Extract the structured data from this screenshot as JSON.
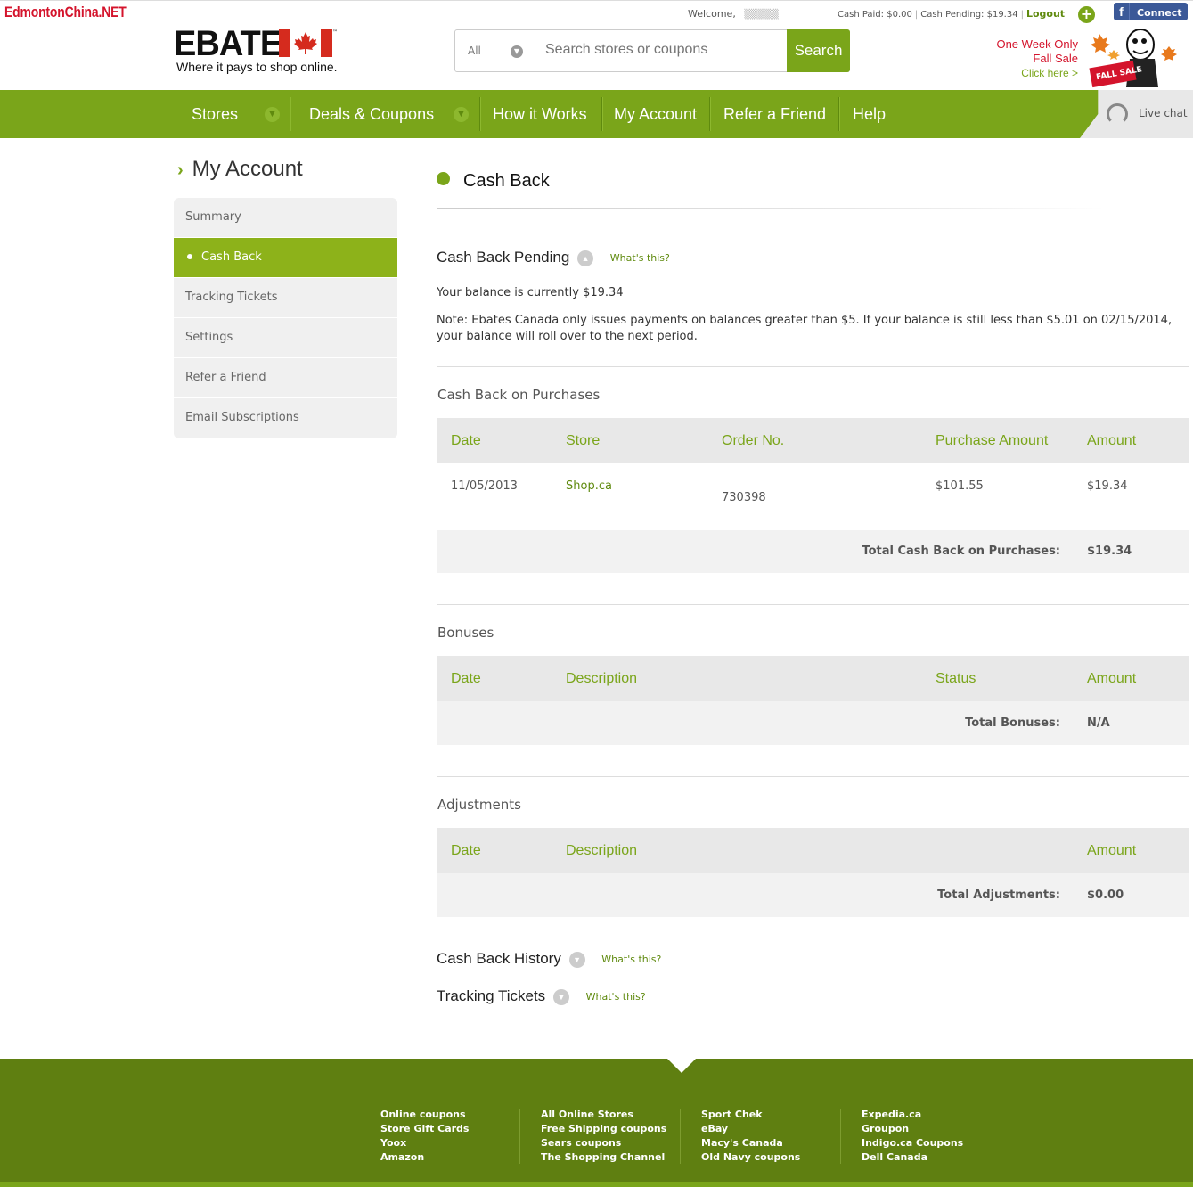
{
  "watermark": "EdmontonChina.NET",
  "header": {
    "welcome_label": "Welcome,",
    "cash_paid": "Cash Paid: $0.00",
    "cash_pending": "Cash Pending: $19.34",
    "logout": "Logout",
    "facebook_connect": "Connect",
    "logo_text": "EBATES",
    "logo_trademark": "™",
    "tagline": "Where it pays to shop online.",
    "promo_line1": "One Week Only",
    "promo_line2": "Fall Sale",
    "promo_link": "Click here >",
    "promo_badge": "FALL SALE"
  },
  "search": {
    "category": "All",
    "placeholder": "Search stores or coupons",
    "button": "Search"
  },
  "nav": {
    "items": [
      "Stores",
      "Deals & Coupons",
      "How it Works",
      "My Account",
      "Refer a Friend",
      "Help"
    ],
    "live_chat": "Live chat"
  },
  "sidebar": {
    "title": "My Account",
    "items": [
      "Summary",
      "Cash Back",
      "Tracking Tickets",
      "Settings",
      "Refer a Friend",
      "Email Subscriptions"
    ],
    "active_index": 1
  },
  "main": {
    "title": "Cash Back",
    "pending": {
      "heading": "Cash Back Pending",
      "whats_this": "What's this?",
      "balance": "Your balance is currently $19.34",
      "note": "Note: Ebates Canada only issues payments on balances greater than $5. If your balance is still less than $5.01 on 02/15/2014, your balance will roll over to the next period."
    },
    "purchases": {
      "heading": "Cash Back on Purchases",
      "columns": [
        "Date",
        "Store",
        "Order No.",
        "Purchase Amount",
        "Amount"
      ],
      "rows": [
        {
          "date": "11/05/2013",
          "store": "Shop.ca",
          "order_no": "730398",
          "purchase_amount": "$101.55",
          "amount": "$19.34"
        }
      ],
      "total_label": "Total Cash Back on Purchases:",
      "total_value": "$19.34"
    },
    "bonuses": {
      "heading": "Bonuses",
      "columns": [
        "Date",
        "Description",
        "Status",
        "Amount"
      ],
      "total_label": "Total Bonuses:",
      "total_value": "N/A"
    },
    "adjustments": {
      "heading": "Adjustments",
      "columns": [
        "Date",
        "Description",
        "Amount"
      ],
      "total_label": "Total Adjustments:",
      "total_value": "$0.00"
    },
    "history": {
      "heading": "Cash Back History",
      "whats_this": "What's this?"
    },
    "tickets": {
      "heading": "Tracking Tickets",
      "whats_this": "What's this?"
    }
  },
  "footer": {
    "col1": [
      "Online coupons",
      "Store Gift Cards",
      "Yoox",
      "Amazon"
    ],
    "col2": [
      "All Online Stores",
      "Free Shipping coupons",
      "Sears coupons",
      "The Shopping Channel"
    ],
    "col3": [
      "Sport Chek",
      "eBay",
      "Macy's Canada",
      "Old Navy coupons"
    ],
    "col4": [
      "Expedia.ca",
      "Groupon",
      "Indigo.ca Coupons",
      "Dell Canada"
    ]
  },
  "colors": {
    "brand_green": "#7aa51a",
    "dark_green": "#5f7f11",
    "red": "#d4142c",
    "facebook": "#3b5998"
  }
}
